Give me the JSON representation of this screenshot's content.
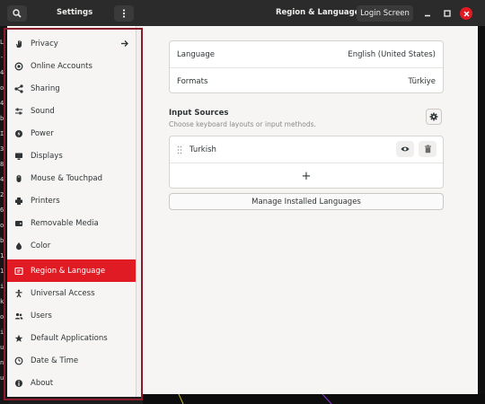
{
  "header": {
    "search_icon": "search-icon",
    "settings_title": "Settings",
    "menu_icon": "vertical-dots-icon",
    "panel_title": "Region & Language",
    "login_button": "Login Screen",
    "minimize_icon": "minimize-icon",
    "maximize_icon": "maximize-icon",
    "close_icon": "close-icon"
  },
  "terminal_chars": [
    "L",
    "-",
    "4",
    "o",
    "4",
    "b",
    "I",
    "3",
    "8",
    "4",
    "2",
    "6",
    "o",
    "b",
    "1",
    "1",
    "i",
    "k",
    "o",
    "i",
    "u",
    "n",
    "u"
  ],
  "sidebar": {
    "items": [
      {
        "label": "Privacy",
        "icon": "hand-icon",
        "arrow": "arrow-right-icon"
      },
      {
        "label": "Online Accounts",
        "icon": "circle-icon"
      },
      {
        "label": "Sharing",
        "icon": "share-icon"
      },
      {
        "label": "Sound",
        "icon": "sound-icon"
      },
      {
        "label": "Power",
        "icon": "power-icon"
      },
      {
        "label": "Displays",
        "icon": "display-icon"
      },
      {
        "label": "Mouse & Touchpad",
        "icon": "mouse-icon"
      },
      {
        "label": "Printers",
        "icon": "printer-icon"
      },
      {
        "label": "Removable Media",
        "icon": "media-icon"
      },
      {
        "label": "Color",
        "icon": "color-icon"
      },
      {
        "label": "Region & Language",
        "icon": "region-icon",
        "active": true
      },
      {
        "label": "Universal Access",
        "icon": "accessibility-icon"
      },
      {
        "label": "Users",
        "icon": "users-icon"
      },
      {
        "label": "Default Applications",
        "icon": "star-icon"
      },
      {
        "label": "Date & Time",
        "icon": "clock-icon"
      },
      {
        "label": "About",
        "icon": "info-icon"
      }
    ]
  },
  "main": {
    "language_label": "Language",
    "language_value": "English (United States)",
    "formats_label": "Formats",
    "formats_value": "Türkiye",
    "input_sources_title": "Input Sources",
    "input_sources_subtitle": "Choose keyboard layouts or input methods.",
    "input_source_name": "Turkish",
    "add_symbol": "+",
    "manage_button": "Manage Installed Languages"
  },
  "colors": {
    "accent": "#e01b24",
    "frame": "#8b1a2a",
    "header": "#2b2b2b"
  }
}
